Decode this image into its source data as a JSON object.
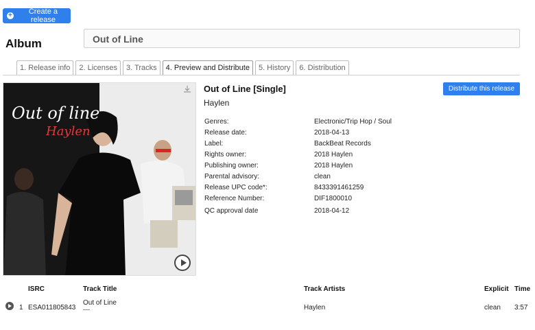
{
  "toolbar": {
    "create_label": "Create a release"
  },
  "album": {
    "label": "Album",
    "title": "Out of Line"
  },
  "tabs": [
    {
      "label": "1. Release info"
    },
    {
      "label": "2. Licenses"
    },
    {
      "label": "3. Tracks"
    },
    {
      "label": "4. Preview and Distribute",
      "active": true
    },
    {
      "label": "5. History"
    },
    {
      "label": "6. Distribution"
    }
  ],
  "release": {
    "title": "Out of Line [Single]",
    "artist": "Haylen",
    "distribute_label": "Distribute this release",
    "cover_text": {
      "title": "Out of line",
      "artist": "Haylen"
    },
    "meta": [
      {
        "key": "Genres:",
        "value": "Electronic/Trip Hop / Soul"
      },
      {
        "key": "Release date:",
        "value": "2018-04-13"
      },
      {
        "key": "Label:",
        "value": "BackBeat Records"
      },
      {
        "key": "Rights owner:",
        "value": "2018 Haylen"
      },
      {
        "key": "Publishing owner:",
        "value": "2018 Haylen"
      },
      {
        "key": "Parental advisory:",
        "value": "clean"
      },
      {
        "key": "Release UPC code*:",
        "value": "8433391461259"
      },
      {
        "key": "Reference Number:",
        "value": "DIF1800010"
      },
      {
        "key": "QC approval date",
        "value": "2018-04-12"
      }
    ]
  },
  "tracks": {
    "headers": {
      "isrc": "ISRC",
      "title": "Track Title",
      "artists": "Track Artists",
      "explicit": "Explicit",
      "time": "Time"
    },
    "rows": [
      {
        "num": "1",
        "isrc": "ESA011805843",
        "title": "Out of Line",
        "title_sub": "—",
        "artists": "Haylen",
        "explicit": "clean",
        "time": "3:57"
      }
    ]
  },
  "colors": {
    "accent": "#2f80ed"
  },
  "icons": {
    "create": "plus-circle-icon",
    "download": "download-icon",
    "play": "play-icon"
  }
}
